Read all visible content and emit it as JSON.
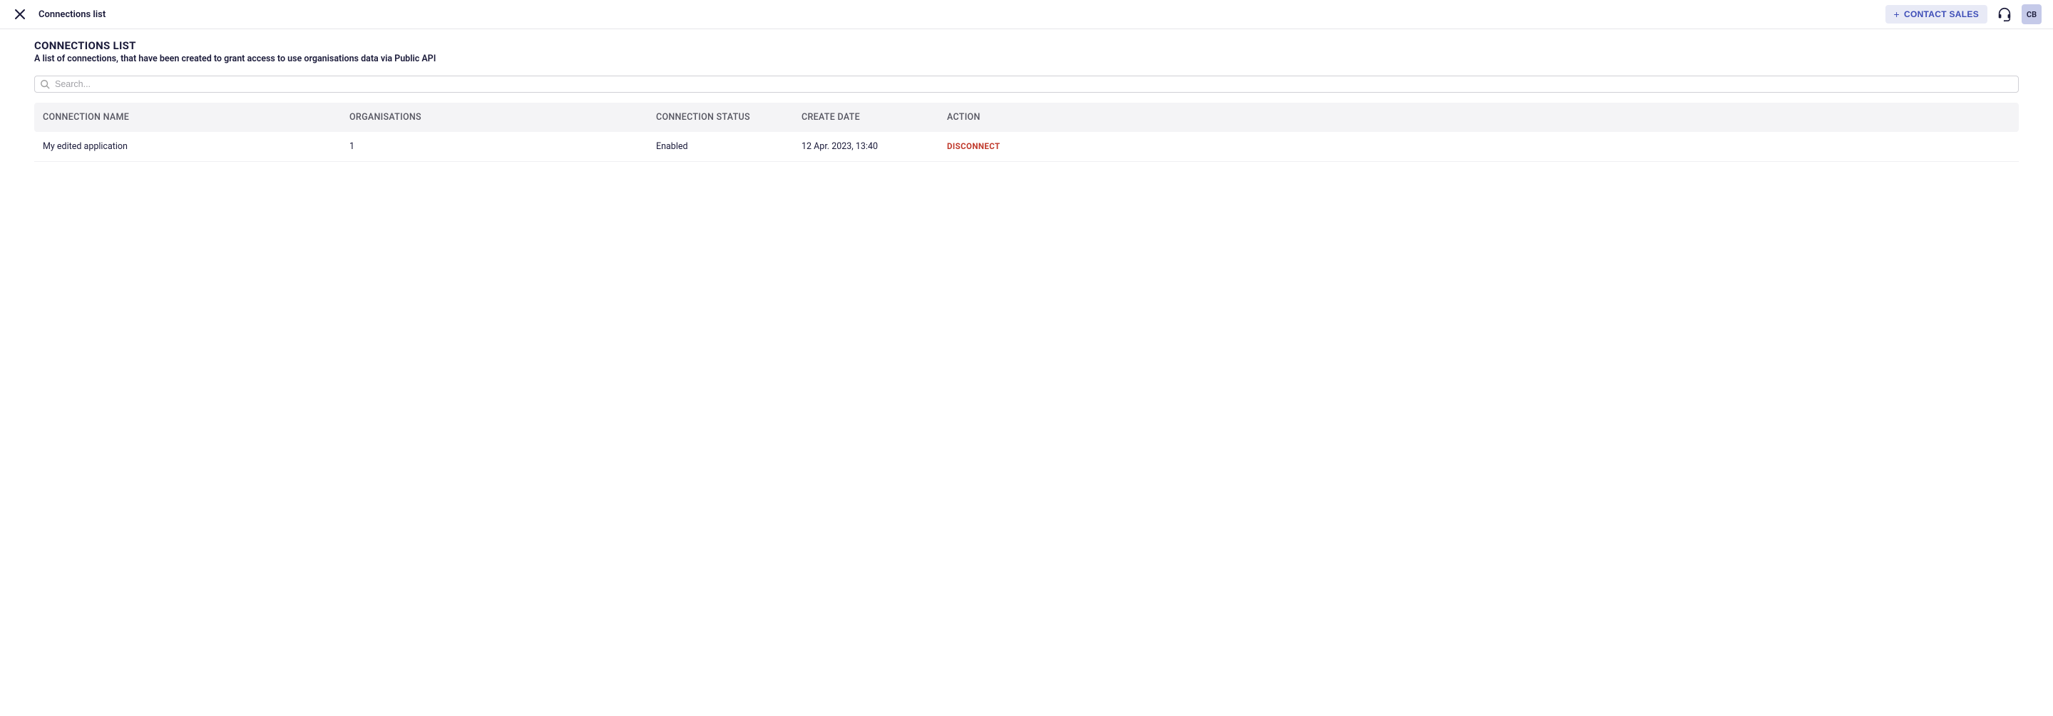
{
  "header": {
    "breadcrumb": "Connections list",
    "contact_sales_label": "CONTACT SALES",
    "avatar_initials": "CB"
  },
  "page": {
    "title": "CONNECTIONS LIST",
    "subtitle": "A list of connections, that have been created to grant access to use organisations data via Public API"
  },
  "search": {
    "placeholder": "Search..."
  },
  "table": {
    "columns": {
      "name": "CONNECTION NAME",
      "orgs": "ORGANISATIONS",
      "status": "CONNECTION STATUS",
      "date": "CREATE DATE",
      "action": "ACTION"
    },
    "rows": [
      {
        "name": "My edited application",
        "orgs": "1",
        "status": "Enabled",
        "date": "12 Apr. 2023, 13:40",
        "action": "DISCONNECT"
      }
    ]
  }
}
